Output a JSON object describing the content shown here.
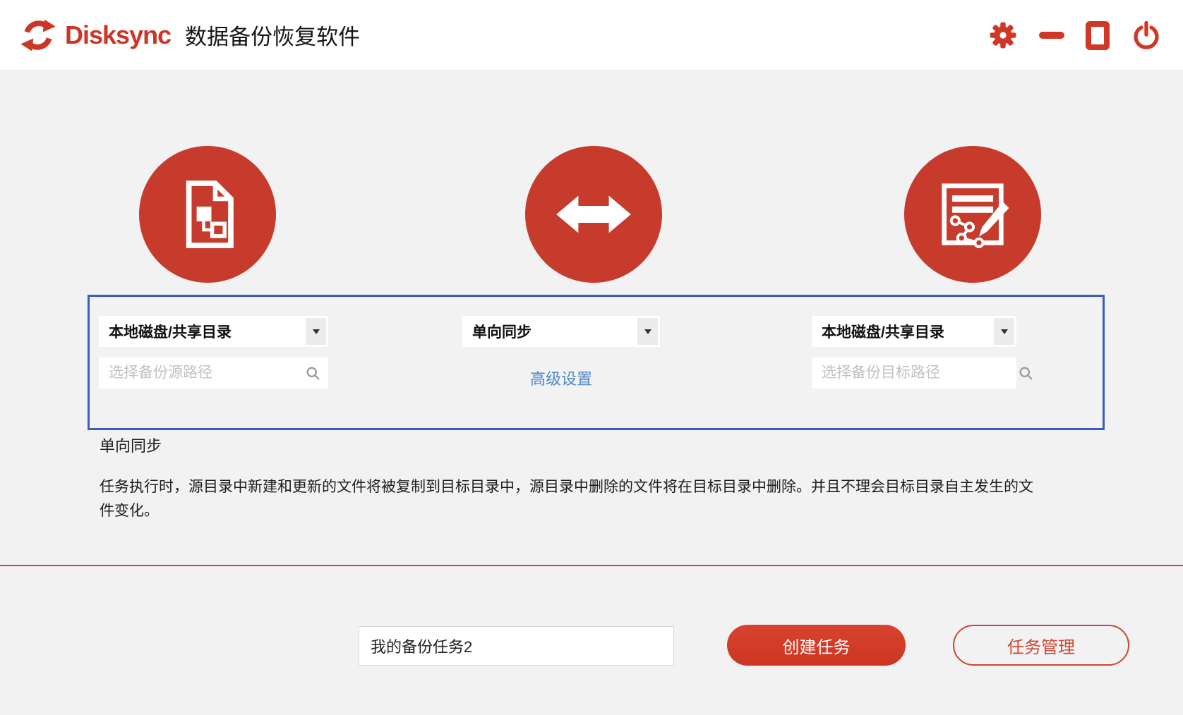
{
  "header": {
    "brand": "Disksync",
    "title": "数据备份恢复软件"
  },
  "window_controls": {
    "settings_icon": "gear",
    "minimize_icon": "minus-bar",
    "maximize_icon": "square-outline",
    "close_icon": "power-symbol"
  },
  "wizard": {
    "source": {
      "icon": "document-tree-icon",
      "type_selected": "本地磁盘/共享目录",
      "path_placeholder": "选择备份源路径",
      "search_icon": "magnifier"
    },
    "mode": {
      "icon": "double-arrow-icon",
      "mode_selected": "单向同步",
      "advanced_link": "高级设置"
    },
    "target": {
      "icon": "document-edit-icon",
      "type_selected": "本地磁盘/共享目录",
      "path_placeholder": "选择备份目标路径",
      "search_icon": "magnifier"
    }
  },
  "mode_info": {
    "title": "单向同步",
    "description": "任务执行时，源目录中新建和更新的文件将被复制到目标目录中，源目录中删除的文件将在目标目录中删除。并且不理会目标目录自主发生的文件变化。"
  },
  "task_bar": {
    "task_name_value": "我的备份任务2",
    "create_button": "创建任务",
    "manage_button": "任务管理"
  },
  "colors": {
    "brand_red": "#ce3526",
    "circle_red": "#c63b2b",
    "button_red": "#d23e2b",
    "panel_border_blue": "#3c5cc2",
    "link_blue": "#4f86c6",
    "background_gray": "#f2f2f2"
  }
}
